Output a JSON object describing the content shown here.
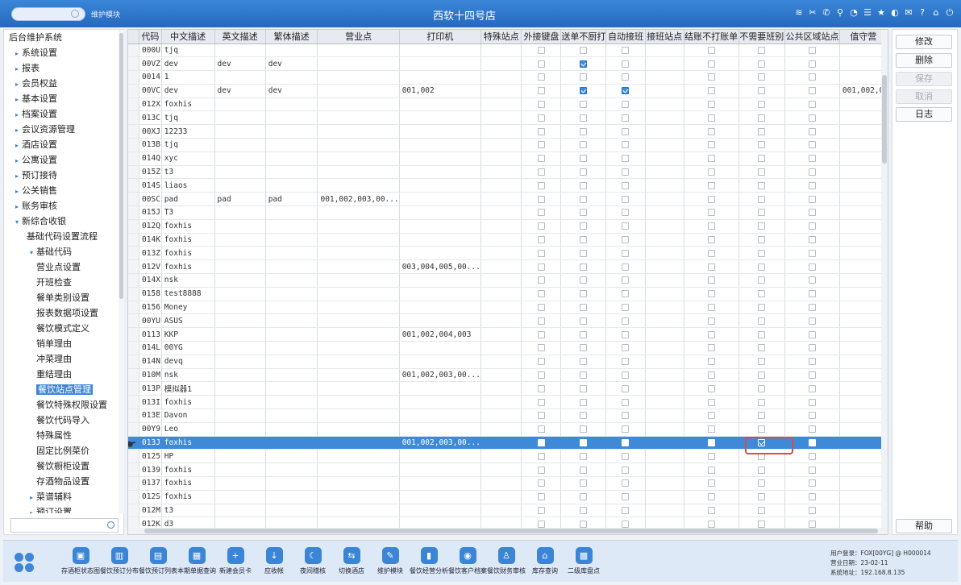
{
  "topbar": {
    "module": "维护模块",
    "title": "西软十四号店",
    "icons": [
      "wifi-icon",
      "tools-icon",
      "phone-icon",
      "search-icon",
      "palette-icon",
      "menu-icon",
      "star-icon",
      "contrast-icon",
      "mail-icon",
      "help-icon",
      "home-icon",
      "power-icon"
    ],
    "glyphs": [
      "≋",
      "✂",
      "✆",
      "⚲",
      "◔",
      "☰",
      "★",
      "◐",
      "✉",
      "?",
      "⌂",
      "⏻"
    ]
  },
  "tree": [
    {
      "label": "后台维护系统",
      "level": 0,
      "arrow": ""
    },
    {
      "label": "系统设置",
      "level": 1,
      "arrow": "▸"
    },
    {
      "label": "报表",
      "level": 1,
      "arrow": "▸"
    },
    {
      "label": "会员权益",
      "level": 1,
      "arrow": "▸"
    },
    {
      "label": "基本设置",
      "level": 1,
      "arrow": "▸"
    },
    {
      "label": "档案设置",
      "level": 1,
      "arrow": "▸"
    },
    {
      "label": "会议资源管理",
      "level": 1,
      "arrow": "▸"
    },
    {
      "label": "酒店设置",
      "level": 1,
      "arrow": "▸"
    },
    {
      "label": "公寓设置",
      "level": 1,
      "arrow": "▸"
    },
    {
      "label": "预订接待",
      "level": 1,
      "arrow": "▸"
    },
    {
      "label": "公关销售",
      "level": 1,
      "arrow": "▸"
    },
    {
      "label": "账务审核",
      "level": 1,
      "arrow": "▸"
    },
    {
      "label": "新综合收银",
      "level": 1,
      "arrow": "▾"
    },
    {
      "label": "基础代码设置流程",
      "level": 2,
      "arrow": ""
    },
    {
      "label": "基础代码",
      "level": 2,
      "arrow": "▾"
    },
    {
      "label": "营业点设置",
      "level": 3,
      "arrow": ""
    },
    {
      "label": "开班检查",
      "level": 3,
      "arrow": ""
    },
    {
      "label": "餐单类别设置",
      "level": 3,
      "arrow": ""
    },
    {
      "label": "报表数据项设置",
      "level": 3,
      "arrow": ""
    },
    {
      "label": "餐饮模式定义",
      "level": 3,
      "arrow": ""
    },
    {
      "label": "销单理由",
      "level": 3,
      "arrow": ""
    },
    {
      "label": "冲菜理由",
      "level": 3,
      "arrow": ""
    },
    {
      "label": "重结理由",
      "level": 3,
      "arrow": ""
    },
    {
      "label": "餐饮站点管理",
      "level": 3,
      "arrow": "",
      "selected": true
    },
    {
      "label": "餐饮特殊权限设置",
      "level": 3,
      "arrow": ""
    },
    {
      "label": "餐饮代码导入",
      "level": 3,
      "arrow": ""
    },
    {
      "label": "特殊属性",
      "level": 3,
      "arrow": ""
    },
    {
      "label": "固定比例菜价",
      "level": 3,
      "arrow": ""
    },
    {
      "label": "餐饮橱柜设置",
      "level": 3,
      "arrow": ""
    },
    {
      "label": "存酒物品设置",
      "level": 3,
      "arrow": ""
    },
    {
      "label": "菜谱辅料",
      "level": 2,
      "arrow": "▸"
    },
    {
      "label": "预订设置",
      "level": 2,
      "arrow": "▸"
    }
  ],
  "columns": [
    "代码",
    "中文描述",
    "英文描述",
    "繁体描述",
    "营业点",
    "打印机",
    "特殊站点",
    "外接键盘",
    "送单不厨打",
    "自动接班",
    "接班站点",
    "结账不打账单",
    "不需要班别",
    "公共区域站点",
    "值守营"
  ],
  "checkbox_columns": [
    7,
    8,
    9,
    11,
    12,
    13
  ],
  "rows": [
    {
      "code": "000U",
      "cn": "tjq",
      "en": "",
      "tw": "",
      "outlet": "",
      "printer": "",
      "checks": [
        0,
        0,
        0,
        0,
        0,
        0
      ]
    },
    {
      "code": "00VZ",
      "cn": "dev",
      "en": "dev",
      "tw": "dev",
      "outlet": "",
      "printer": "",
      "checks": [
        0,
        1,
        0,
        0,
        0,
        0
      ]
    },
    {
      "code": "0014",
      "cn": "1",
      "en": "",
      "tw": "",
      "outlet": "",
      "printer": "",
      "checks": [
        0,
        0,
        0,
        0,
        0,
        0
      ]
    },
    {
      "code": "00VC",
      "cn": "dev",
      "en": "dev",
      "tw": "dev",
      "outlet": "",
      "printer": "001,002",
      "checks": [
        0,
        1,
        1,
        0,
        0,
        0
      ],
      "extra": "001,002,0"
    },
    {
      "code": "012X",
      "cn": "foxhis",
      "en": "",
      "tw": "",
      "outlet": "",
      "printer": "",
      "checks": [
        0,
        0,
        0,
        0,
        0,
        0
      ]
    },
    {
      "code": "013C",
      "cn": "tjq",
      "en": "",
      "tw": "",
      "outlet": "",
      "printer": "",
      "checks": [
        0,
        0,
        0,
        0,
        0,
        0
      ]
    },
    {
      "code": "00XJ",
      "cn": "12233",
      "en": "",
      "tw": "",
      "outlet": "",
      "printer": "",
      "checks": [
        0,
        0,
        0,
        0,
        0,
        0
      ]
    },
    {
      "code": "013B",
      "cn": "tjq",
      "en": "",
      "tw": "",
      "outlet": "",
      "printer": "",
      "checks": [
        0,
        0,
        0,
        0,
        0,
        0
      ]
    },
    {
      "code": "014Q",
      "cn": "xyc",
      "en": "",
      "tw": "",
      "outlet": "",
      "printer": "",
      "checks": [
        0,
        0,
        0,
        0,
        0,
        0
      ]
    },
    {
      "code": "015Z",
      "cn": "t3",
      "en": "",
      "tw": "",
      "outlet": "",
      "printer": "",
      "checks": [
        0,
        0,
        0,
        0,
        0,
        0
      ]
    },
    {
      "code": "014S",
      "cn": "liaos",
      "en": "",
      "tw": "",
      "outlet": "",
      "printer": "",
      "checks": [
        0,
        0,
        0,
        0,
        0,
        0
      ]
    },
    {
      "code": "00SC",
      "cn": "pad",
      "en": "pad",
      "tw": "pad",
      "outlet": "001,002,003,00...",
      "printer": "",
      "checks": [
        0,
        0,
        0,
        0,
        0,
        0
      ]
    },
    {
      "code": "015J",
      "cn": "T3",
      "en": "",
      "tw": "",
      "outlet": "",
      "printer": "",
      "checks": [
        0,
        0,
        0,
        0,
        0,
        0
      ]
    },
    {
      "code": "012Q",
      "cn": "foxhis",
      "en": "",
      "tw": "",
      "outlet": "",
      "printer": "",
      "checks": [
        0,
        0,
        0,
        0,
        0,
        0
      ]
    },
    {
      "code": "014K",
      "cn": "foxhis",
      "en": "",
      "tw": "",
      "outlet": "",
      "printer": "",
      "checks": [
        0,
        0,
        0,
        0,
        0,
        0
      ]
    },
    {
      "code": "013Z",
      "cn": "foxhis",
      "en": "",
      "tw": "",
      "outlet": "",
      "printer": "",
      "checks": [
        0,
        0,
        0,
        0,
        0,
        0
      ]
    },
    {
      "code": "012V",
      "cn": "foxhis",
      "en": "",
      "tw": "",
      "outlet": "",
      "printer": "003,004,005,00...",
      "checks": [
        0,
        0,
        0,
        0,
        0,
        0
      ]
    },
    {
      "code": "014X",
      "cn": "nsk",
      "en": "",
      "tw": "",
      "outlet": "",
      "printer": "",
      "checks": [
        0,
        0,
        0,
        0,
        0,
        0
      ]
    },
    {
      "code": "0158",
      "cn": "test8888",
      "en": "",
      "tw": "",
      "outlet": "",
      "printer": "",
      "checks": [
        0,
        0,
        0,
        0,
        0,
        0
      ]
    },
    {
      "code": "0156",
      "cn": "Money",
      "en": "",
      "tw": "",
      "outlet": "",
      "printer": "",
      "checks": [
        0,
        0,
        0,
        0,
        0,
        0
      ]
    },
    {
      "code": "00YU",
      "cn": "ASUS",
      "en": "",
      "tw": "",
      "outlet": "",
      "printer": "",
      "checks": [
        0,
        0,
        0,
        0,
        0,
        0
      ]
    },
    {
      "code": "0113",
      "cn": "KKP",
      "en": "",
      "tw": "",
      "outlet": "",
      "printer": "001,002,004,003",
      "checks": [
        0,
        0,
        0,
        0,
        0,
        0
      ]
    },
    {
      "code": "014L",
      "cn": "00YG",
      "en": "",
      "tw": "",
      "outlet": "",
      "printer": "",
      "checks": [
        0,
        0,
        0,
        0,
        0,
        0
      ]
    },
    {
      "code": "014N",
      "cn": "devq",
      "en": "",
      "tw": "",
      "outlet": "",
      "printer": "",
      "checks": [
        0,
        0,
        0,
        0,
        0,
        0
      ]
    },
    {
      "code": "010M",
      "cn": "nsk",
      "en": "",
      "tw": "",
      "outlet": "",
      "printer": "001,002,003,00...",
      "checks": [
        0,
        0,
        0,
        0,
        0,
        0
      ]
    },
    {
      "code": "013P",
      "cn": "模拟器1",
      "en": "",
      "tw": "",
      "outlet": "",
      "printer": "",
      "checks": [
        0,
        0,
        0,
        0,
        0,
        0
      ]
    },
    {
      "code": "013I",
      "cn": "foxhis",
      "en": "",
      "tw": "",
      "outlet": "",
      "printer": "",
      "checks": [
        0,
        0,
        0,
        0,
        0,
        0
      ]
    },
    {
      "code": "013E",
      "cn": "Davon",
      "en": "",
      "tw": "",
      "outlet": "",
      "printer": "",
      "checks": [
        0,
        0,
        0,
        0,
        0,
        0
      ]
    },
    {
      "code": "00Y9",
      "cn": "Leo",
      "en": "",
      "tw": "",
      "outlet": "",
      "printer": "",
      "checks": [
        0,
        0,
        0,
        0,
        0,
        0
      ]
    },
    {
      "code": "013J",
      "cn": "foxhis",
      "en": "",
      "tw": "",
      "outlet": "",
      "printer": "001,002,003,00...",
      "checks": [
        0,
        0,
        0,
        0,
        1,
        0
      ],
      "highlight": true
    },
    {
      "code": "0125",
      "cn": "HP",
      "en": "",
      "tw": "",
      "outlet": "",
      "printer": "",
      "checks": [
        0,
        0,
        0,
        0,
        0,
        0
      ]
    },
    {
      "code": "0139",
      "cn": "foxhis",
      "en": "",
      "tw": "",
      "outlet": "",
      "printer": "",
      "checks": [
        0,
        0,
        0,
        0,
        0,
        0
      ]
    },
    {
      "code": "0137",
      "cn": "foxhis",
      "en": "",
      "tw": "",
      "outlet": "",
      "printer": "",
      "checks": [
        0,
        0,
        0,
        0,
        0,
        0
      ]
    },
    {
      "code": "012S",
      "cn": "foxhis",
      "en": "",
      "tw": "",
      "outlet": "",
      "printer": "",
      "checks": [
        0,
        0,
        0,
        0,
        0,
        0
      ]
    },
    {
      "code": "012M",
      "cn": "t3",
      "en": "",
      "tw": "",
      "outlet": "",
      "printer": "",
      "checks": [
        0,
        0,
        0,
        0,
        0,
        0
      ]
    },
    {
      "code": "012K",
      "cn": "d3",
      "en": "",
      "tw": "",
      "outlet": "",
      "printer": "",
      "checks": [
        0,
        0,
        0,
        0,
        0,
        0
      ]
    }
  ],
  "buttons": {
    "edit": "修改",
    "delete": "删除",
    "save": "保存",
    "cancel": "取消",
    "log": "日志",
    "help": "帮助"
  },
  "taskbar": [
    {
      "label": "存酒柜状态图",
      "icon": "▣"
    },
    {
      "label": "餐饮预订分布",
      "icon": "▥"
    },
    {
      "label": "餐饮预订列表",
      "icon": "▤"
    },
    {
      "label": "本期单据查询",
      "icon": "▦"
    },
    {
      "label": "新建会员卡",
      "icon": "+"
    },
    {
      "label": "应收帐",
      "icon": "↓"
    },
    {
      "label": "夜间稽核",
      "icon": "☾"
    },
    {
      "label": "切换酒店",
      "icon": "⇆"
    },
    {
      "label": "维护模块",
      "icon": "✎"
    },
    {
      "label": "餐饮经营分析",
      "icon": "▮"
    },
    {
      "label": "餐饮客户档案",
      "icon": "◉"
    },
    {
      "label": "餐饮财务审核",
      "icon": "♙"
    },
    {
      "label": "库存查询",
      "icon": "⌂"
    },
    {
      "label": "二级库盘点",
      "icon": "▩"
    }
  ],
  "status": {
    "user": "用户登录：FOX[00YG] @ H000014",
    "bizdate": "营业日期：23-02-11",
    "sysaddr": "系统地址：192.168.8.135"
  }
}
